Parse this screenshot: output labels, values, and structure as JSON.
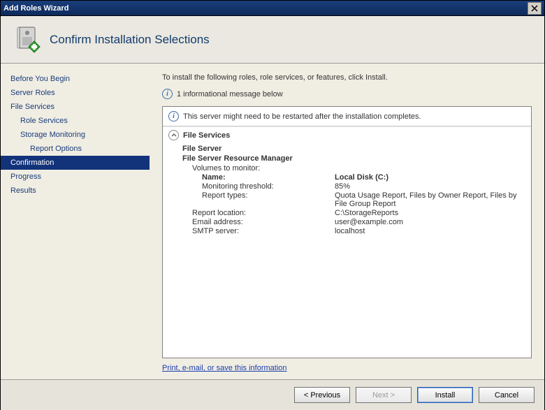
{
  "titlebar": {
    "title": "Add Roles Wizard"
  },
  "page_title": "Confirm Installation Selections",
  "sidebar": {
    "items": [
      {
        "label": "Before You Begin",
        "level": 0
      },
      {
        "label": "Server Roles",
        "level": 0
      },
      {
        "label": "File Services",
        "level": 0
      },
      {
        "label": "Role Services",
        "level": 1
      },
      {
        "label": "Storage Monitoring",
        "level": 1
      },
      {
        "label": "Report Options",
        "level": 2
      },
      {
        "label": "Confirmation",
        "level": 0,
        "active": true
      },
      {
        "label": "Progress",
        "level": 0
      },
      {
        "label": "Results",
        "level": 0
      }
    ]
  },
  "content": {
    "intro": "To install the following roles, role services, or features, click Install.",
    "info_count_text": "1 informational message below",
    "restart_warning": "This server might need to be restarted after the installation completes.",
    "section_title": "File Services",
    "roles": {
      "file_server": "File Server",
      "fsrm": "File Server Resource Manager",
      "volumes_label": "Volumes to monitor:",
      "name_label": "Name:",
      "name_value": "Local Disk (C:)",
      "threshold_label": "Monitoring threshold:",
      "threshold_value": "85%",
      "report_types_label": "Report types:",
      "report_types_value": "Quota Usage Report, Files by Owner Report, Files by File Group Report",
      "report_location_label": "Report location:",
      "report_location_value": "C:\\StorageReports",
      "email_label": "Email address:",
      "email_value": "user@example.com",
      "smtp_label": "SMTP server:",
      "smtp_value": "localhost"
    },
    "link_text": "Print, e-mail, or save this information"
  },
  "footer": {
    "previous": "< Previous",
    "next": "Next >",
    "install": "Install",
    "cancel": "Cancel"
  }
}
